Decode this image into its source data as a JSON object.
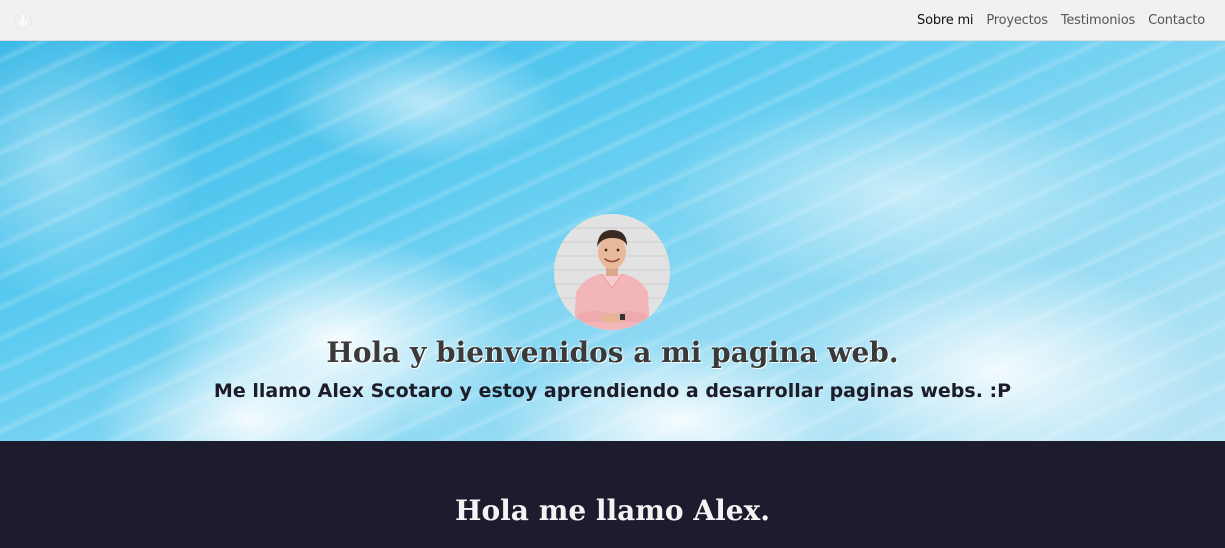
{
  "navbar": {
    "logo_icon": "circle-arrow-down-icon",
    "links": [
      {
        "label": "Sobre mi",
        "active": true
      },
      {
        "label": "Proyectos",
        "active": false
      },
      {
        "label": "Testimonios",
        "active": false
      },
      {
        "label": "Contacto",
        "active": false
      }
    ]
  },
  "hero": {
    "title": "Hola y bienvenidos a mi pagina web.",
    "subtitle": "Me llamo Alex Scotaro y estoy aprendiendo a desarrollar paginas webs. :P"
  },
  "about": {
    "title": "Hola me llamo Alex."
  },
  "colors": {
    "navbar_bg": "#f1f1f1",
    "about_bg": "#1c1c2e",
    "sky": "#5ccbf0"
  }
}
